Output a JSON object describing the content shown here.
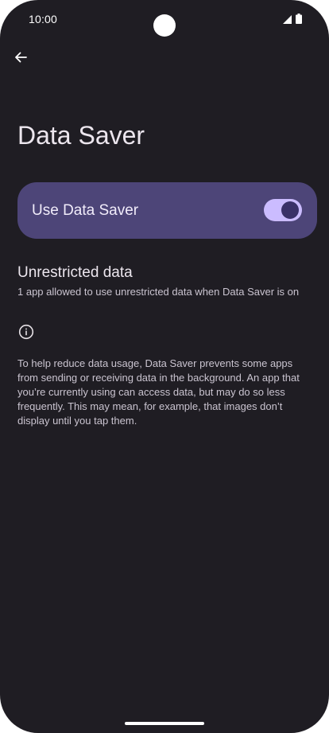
{
  "status_bar": {
    "time": "10:00",
    "icons": [
      "cell-signal-icon",
      "battery-icon"
    ]
  },
  "header": {
    "back_icon": "arrow-back-icon",
    "title": "Data Saver"
  },
  "toggle": {
    "label": "Use Data Saver",
    "enabled": true
  },
  "unrestricted": {
    "title": "Unrestricted data",
    "summary": "1 app allowed to use unrestricted data when Data Saver is on"
  },
  "footer": {
    "info_icon": "info-icon",
    "text": "To help reduce data usage, Data Saver prevents some apps from sending or receiving data in the background. An app that you’re currently using can access data, but may do so less frequently. This may mean, for example, that images don’t display until you tap them."
  },
  "colors": {
    "background": "#1f1d23",
    "card": "#4d4578",
    "switch_track": "#cbbcff",
    "switch_thumb": "#3a3168"
  }
}
